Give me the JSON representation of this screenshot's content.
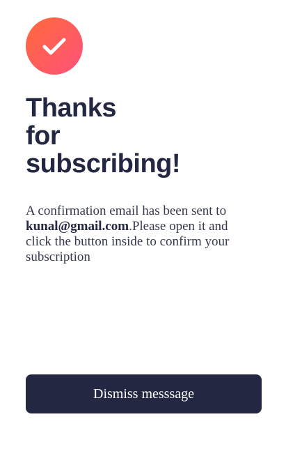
{
  "badge": {
    "icon": "check-icon",
    "gradient_start": "#ff6a3a",
    "gradient_end": "#ff527b"
  },
  "heading": {
    "line1": "Thanks",
    "line2": "for",
    "line3": "subscribing!"
  },
  "message": {
    "before_email": "A confirmation email has been sent to ",
    "email": "kunal@gmail.com",
    "after_email": ".Please open it and click the button inside to confirm your subscription"
  },
  "dismiss_button": {
    "label": "Dismiss messsage"
  },
  "colors": {
    "dark_navy": "#242742",
    "text": "#36384e",
    "background": "#ffffff"
  }
}
